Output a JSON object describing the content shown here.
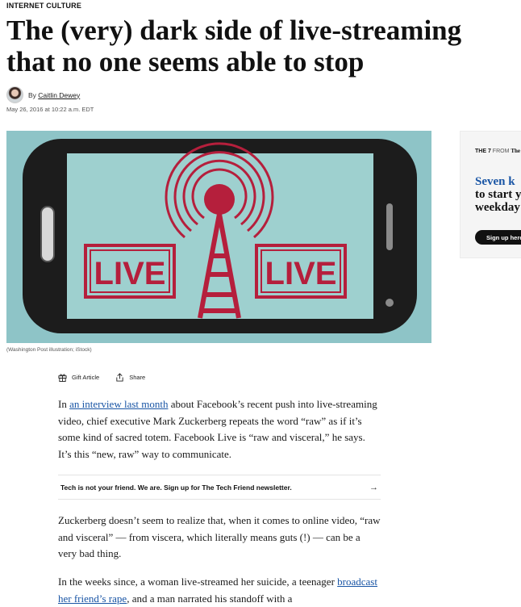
{
  "kicker": "INTERNET CULTURE",
  "headline": "The (very) dark side of live-streaming that no one seems able to stop",
  "byline": {
    "prefix": "By",
    "author": "Caitlin Dewey",
    "date": "May 26, 2016 at 10:22 a.m. EDT"
  },
  "hero": {
    "sign_left": "LIVE",
    "sign_right": "LIVE",
    "caption": "(Washington Post illustration; iStock)"
  },
  "rail_ad": {
    "brand": "THE 7",
    "from": "FROM",
    "source": "The W",
    "headline_lines": [
      "Seven k",
      "to start y",
      "weekday"
    ],
    "cta": "Sign up here"
  },
  "share": {
    "gift_label": "Gift Article",
    "share_label": "Share"
  },
  "article": {
    "p1_pre": "In ",
    "p1_link": "an interview last month",
    "p1_post": " about Facebook’s recent push into live-streaming video, chief executive Mark Zuckerberg repeats the word “raw” as if it’s some kind of sacred totem. Facebook Live is “raw and visceral,” he says. It’s this “new, raw” way to communicate.",
    "newsletter": "Tech is not your friend. We are. Sign up for The Tech Friend newsletter.",
    "p2": "Zuckerberg doesn’t seem to realize that, when it comes to online video, “raw and visceral” — from viscera, which literally means guts (!) — can be a very bad thing.",
    "p3_pre": "In the weeks since, a woman live-streamed her suicide, a teenager ",
    "p3_link": "broadcast her friend’s rape",
    "p3_post": ", and a man narrated his standoff with a"
  },
  "colors": {
    "link": "#1955a5",
    "hero_bg": "#8ec4c7",
    "screen": "#9ed0cf",
    "accent_red": "#b51f3c"
  }
}
